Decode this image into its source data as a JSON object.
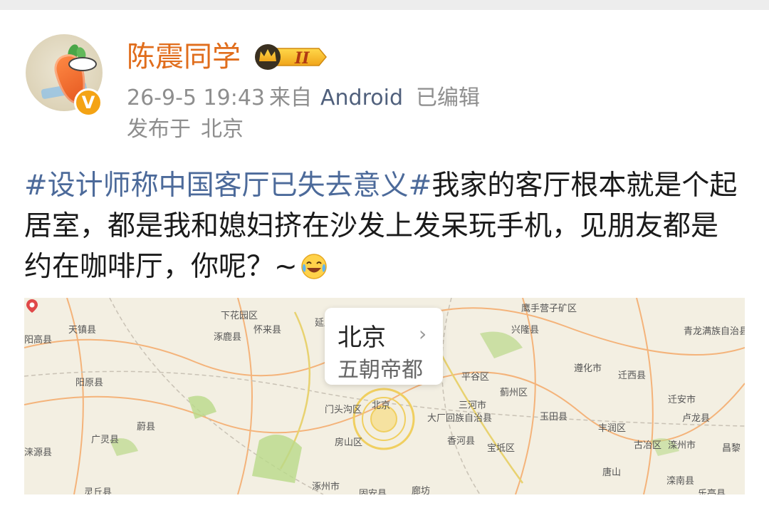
{
  "user": {
    "name": "陈震同学",
    "member_level": "II"
  },
  "meta": {
    "time": "26-9-5 19:43",
    "from_label": "来自",
    "device": "Android",
    "edited": "已编辑",
    "location_prefix": "发布于",
    "location": "北京"
  },
  "post": {
    "hashtag": "#设计师称中国客厅已失去意义#",
    "text": "我家的客厅根本就是个起居室，都是我和媳妇挤在沙发上发呆玩手机，见朋友都是约在咖啡厅，你呢？~"
  },
  "map": {
    "card_title": "北京",
    "card_subtitle": "五朝帝都",
    "places": [
      "阳高县",
      "天镇县",
      "下花园区",
      "怀来县",
      "涿鹿县",
      "延庆",
      "兴隆县",
      "鹰手营子矿区",
      "青龙满族自治县",
      "阳原县",
      "平谷区",
      "遵化市",
      "迁西县",
      "蔚县",
      "门头沟区",
      "北京",
      "三河市",
      "蓟州区",
      "大厂回族自治县",
      "玉田县",
      "迁安市",
      "卢龙县",
      "广灵县",
      "房山区",
      "香河县",
      "宝坻区",
      "丰润区",
      "古冶区",
      "滦州市",
      "昌黎",
      "涞源县",
      "涿州市",
      "廊坊",
      "唐山",
      "滦南县",
      "固安县",
      "灵丘县",
      "乐亭县"
    ]
  },
  "colors": {
    "username": "#e06d1c",
    "hashtag": "#4c6a9a",
    "device": "#50607c",
    "meta": "#8e8e8e",
    "verified_badge": "#f4a314"
  },
  "icons": {
    "verified": "verified-v-icon",
    "member": "crown-member-icon",
    "emoji": "laughing-tears-emoji",
    "chevron": "chevron-right-icon",
    "pin": "map-pin-icon"
  }
}
